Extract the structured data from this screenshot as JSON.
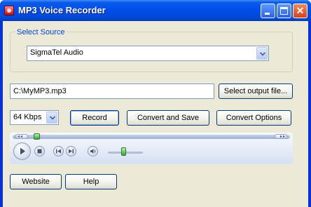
{
  "window": {
    "title": "MP3 Voice Recorder",
    "minimize_icon": "minimize-icon",
    "maximize_icon": "maximize-icon",
    "close_icon": "close-icon"
  },
  "source_group": {
    "label": "Select Source",
    "selected": "SigmaTel Audio"
  },
  "output": {
    "path": "C:\\MyMP3.mp3",
    "select_button": "Select output file..."
  },
  "controls": {
    "bitrate": "64 Kbps",
    "record": "Record",
    "convert_save": "Convert and Save",
    "convert_options": "Convert Options"
  },
  "player": {
    "icons": [
      "seek-back-icon",
      "seek-forward-icon",
      "play-icon",
      "stop-icon",
      "previous-icon",
      "next-icon",
      "volume-icon"
    ]
  },
  "footer": {
    "website": "Website",
    "help": "Help"
  },
  "colors": {
    "titlebar": "#0050ee",
    "client": "#ece9d8",
    "group_label": "#0046d5"
  }
}
